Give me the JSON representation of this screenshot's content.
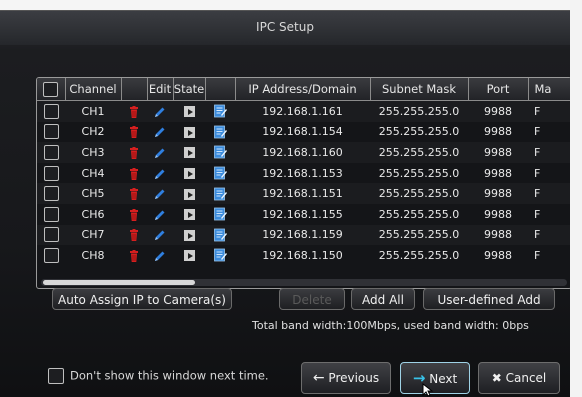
{
  "window": {
    "title": "IPC Setup"
  },
  "table": {
    "headers": [
      "Channel",
      "Edit",
      "State",
      "IP Address/Domain",
      "Subnet Mask",
      "Port",
      "Ma"
    ],
    "rows": [
      {
        "channel": "CH1",
        "ip": "192.168.1.161",
        "mask": "255.255.255.0",
        "port": "9988",
        "extra": "F"
      },
      {
        "channel": "CH2",
        "ip": "192.168.1.154",
        "mask": "255.255.255.0",
        "port": "9988",
        "extra": "F"
      },
      {
        "channel": "CH3",
        "ip": "192.168.1.160",
        "mask": "255.255.255.0",
        "port": "9988",
        "extra": "F"
      },
      {
        "channel": "CH4",
        "ip": "192.168.1.153",
        "mask": "255.255.255.0",
        "port": "9988",
        "extra": "F"
      },
      {
        "channel": "CH5",
        "ip": "192.168.1.151",
        "mask": "255.255.255.0",
        "port": "9988",
        "extra": "F"
      },
      {
        "channel": "CH6",
        "ip": "192.168.1.155",
        "mask": "255.255.255.0",
        "port": "9988",
        "extra": "F"
      },
      {
        "channel": "CH7",
        "ip": "192.168.1.159",
        "mask": "255.255.255.0",
        "port": "9988",
        "extra": "F"
      },
      {
        "channel": "CH8",
        "ip": "192.168.1.150",
        "mask": "255.255.255.0",
        "port": "9988",
        "extra": "F"
      }
    ],
    "scroll_position": 0.0
  },
  "buttons": {
    "auto_assign": "Auto Assign IP to Camera(s)",
    "delete": "Delete",
    "add_all": "Add All",
    "user_defined_add": "User-defined Add"
  },
  "bandwidth_text": "Total band width:100Mbps, used band width: 0bps",
  "footer": {
    "dont_show": "Don't show this window next time.",
    "previous": "Previous",
    "next": "Next",
    "cancel": "Cancel"
  },
  "colors": {
    "delete_icon": "#d61f1f",
    "edit_icon": "#2f7fe0",
    "note_icon": "#3b8bdc",
    "next_arrow": "#39c2e8"
  }
}
